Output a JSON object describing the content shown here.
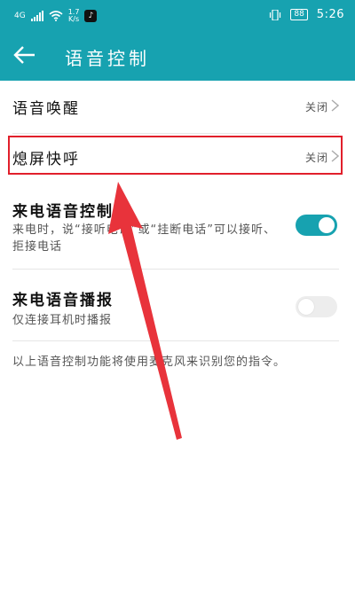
{
  "status_bar": {
    "network": "4G",
    "speed_value": "1.7",
    "speed_unit": "K/s",
    "battery": "88",
    "time": "5:26"
  },
  "app_bar": {
    "title": "语音控制"
  },
  "settings": {
    "voice_wake": {
      "label": "语音唤醒",
      "value": "关闭"
    },
    "quick_call": {
      "label": "熄屏快呼",
      "value": "关闭"
    },
    "incoming_voice_control": {
      "label": "来电语音控制",
      "description": "来电时，说“接听电话”或“挂断电话”可以接听、拒接电话",
      "enabled": true
    },
    "incoming_voice_announce": {
      "label": "来电语音播报",
      "description": "仅连接耳机时播报",
      "enabled": false
    }
  },
  "footer_note": "以上语音控制功能将使用麦克风来识别您的指令。",
  "colors": {
    "primary": "#17a2b0",
    "highlight": "#e11f2b"
  }
}
